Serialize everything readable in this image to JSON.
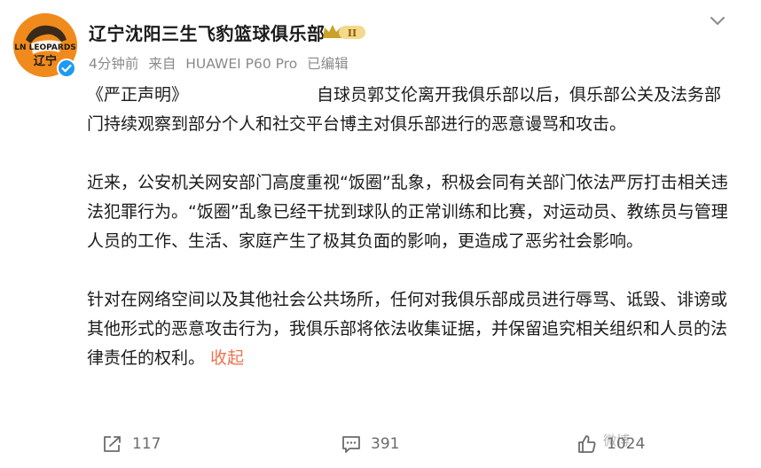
{
  "post": {
    "author_name": "辽宁沈阳三生飞豹篮球俱乐部",
    "vip_level": "II",
    "avatar_text_top": "LN LEOPARDS",
    "avatar_text_bottom": "辽宁",
    "time": "4分钟前",
    "source_prefix": "来自",
    "device": "HUAWEI P60 Pro",
    "edited": "已编辑",
    "paragraphs": [
      "《严正声明》                        自球员郭艾伦离开我俱乐部以后，俱乐部公关及法务部门持续观察到部分个人和社交平台博主对俱乐部进行的恶意谩骂和攻击。",
      "近来，公安机关网安部门高度重视“饭圈”乱象，积极会同有关部门依法严厉打击相关违法犯罪行为。“饭圈”乱象已经干扰到球队的正常训练和比赛，对运动员、教练员与管理人员的工作、生活、家庭产生了极其负面的影响，更造成了恶劣社会影响。",
      "针对在网络空间以及其他社会公共场所，任何对我俱乐部成员进行辱骂、诋毁、诽谤或其他形式的恶意攻击行为，我俱乐部将依法收集证据，并保留追究相关组织和人员的法律责任的权利。"
    ],
    "collapse_label": "收起"
  },
  "actions": {
    "repost_count": "117",
    "comment_count": "391",
    "like_count": "1024"
  },
  "watermark": "微博",
  "icons": [
    "chevron-down-icon",
    "verified-icon",
    "vip-badge-icon",
    "repost-icon",
    "comment-icon",
    "like-icon"
  ],
  "colors": {
    "accent": "#eb7350",
    "verified": "#1d9bf0",
    "avatar_bg": "#f08a1c",
    "meta_text": "#8a8a8a"
  }
}
